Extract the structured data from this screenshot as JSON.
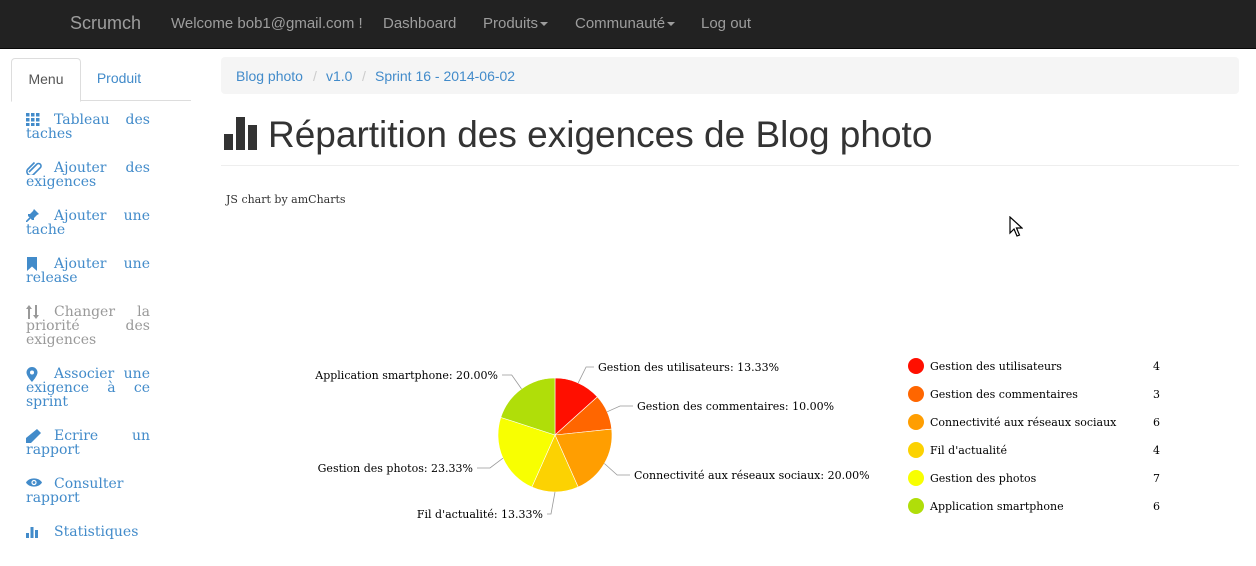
{
  "navbar": {
    "brand": "Scrumch",
    "welcome": "Welcome bob1@gmail.com !",
    "dashboard": "Dashboard",
    "produits": "Produits",
    "communaute": "Communauté",
    "logout": "Log out"
  },
  "sidebar": {
    "tabs": [
      {
        "label": "Menu",
        "active": true
      },
      {
        "label": "Produit",
        "active": false
      }
    ],
    "items": [
      {
        "label": "Tableau des taches",
        "icon": "grid-icon"
      },
      {
        "label": "Ajouter des exigences",
        "icon": "paperclip-icon"
      },
      {
        "label": "Ajouter une tache",
        "icon": "pushpin-icon"
      },
      {
        "label": "Ajouter une release",
        "icon": "bookmark-icon"
      },
      {
        "label": "Changer la priorité des exigences",
        "icon": "sort-arrows-icon",
        "disabled": true
      },
      {
        "label": "Associer une exigence à ce sprint",
        "icon": "map-marker-icon"
      },
      {
        "label": "Ecrire un rapport",
        "icon": "pencil-icon"
      },
      {
        "label": "Consulter rapport",
        "icon": "eye-icon"
      },
      {
        "label": "Statistiques",
        "icon": "stats-icon"
      }
    ]
  },
  "breadcrumb": [
    "Blog photo",
    "v1.0",
    "Sprint 16 - 2014-06-02"
  ],
  "page": {
    "title": "Répartition des exigences de Blog photo",
    "credit": "JS chart by amCharts"
  },
  "colors": {
    "link": "#428bca",
    "navbar_bg": "#222222"
  },
  "chart_data": {
    "type": "pie",
    "series": [
      {
        "name": "Gestion des utilisateurs",
        "value": 4,
        "percent_label": "Gestion des utilisateurs: 13.33%",
        "color": "#ff0f00"
      },
      {
        "name": "Gestion des commentaires",
        "value": 3,
        "percent_label": "Gestion des commentaires: 10.00%",
        "color": "#ff6600"
      },
      {
        "name": "Connectivité aux réseaux sociaux",
        "value": 6,
        "percent_label": "Connectivité aux réseaux sociaux: 20.00%",
        "color": "#ff9e01"
      },
      {
        "name": "Fil d'actualité",
        "value": 4,
        "percent_label": "Fil d'actualité: 13.33%",
        "color": "#fcd202"
      },
      {
        "name": "Gestion des photos",
        "value": 7,
        "percent_label": "Gestion des photos: 23.33%",
        "color": "#f8ff01"
      },
      {
        "name": "Application smartphone",
        "value": 6,
        "percent_label": "Application smartphone: 20.00%",
        "color": "#b0de09"
      }
    ],
    "legend_position": "right"
  }
}
